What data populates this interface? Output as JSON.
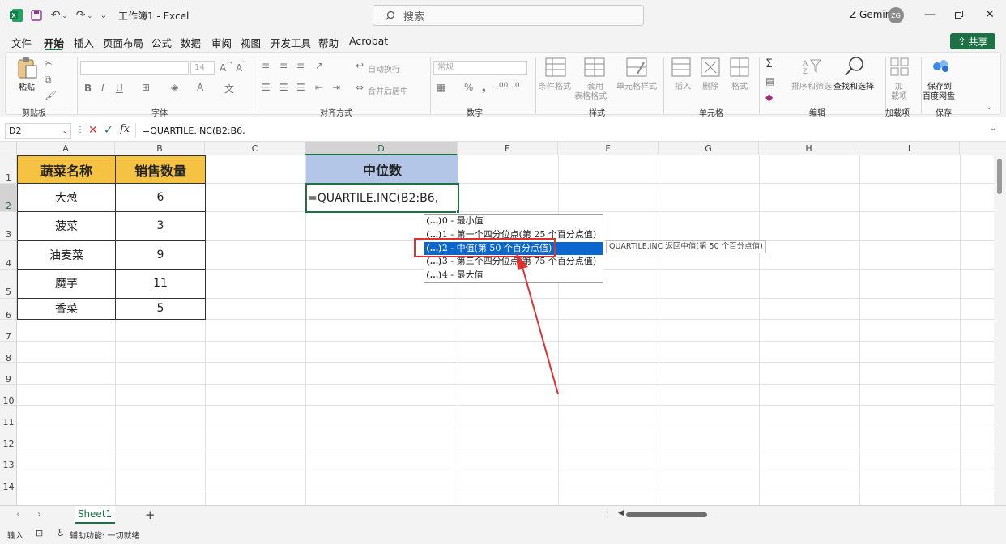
{
  "titlebar": {
    "doc_title": "工作簿1 - Excel",
    "search_placeholder": "搜索",
    "user_name": "Z Gemini",
    "user_initials": "ZG"
  },
  "menu": {
    "tabs": [
      "文件",
      "开始",
      "插入",
      "页面布局",
      "公式",
      "数据",
      "审阅",
      "视图",
      "开发工具",
      "帮助",
      "Acrobat"
    ],
    "active_tab": "开始",
    "share_label": "共享"
  },
  "ribbon": {
    "paste_label": "粘贴",
    "font_size": "14",
    "auto_wrap": "自动换行",
    "merge_center": "合并后居中",
    "number_format": "常规",
    "conditional_format": "条件格式",
    "table_format_1": "套用",
    "table_format_2": "表格格式",
    "cell_style": "单元格样式",
    "insert": "插入",
    "delete": "删除",
    "format": "格式",
    "sort_filter": "排序和筛选",
    "find_select": "查找和选择",
    "addins_1": "加",
    "addins_2": "载项",
    "save_baidu_1": "保存到",
    "save_baidu_2": "百度网盘",
    "groups": {
      "clipboard": "剪贴板",
      "font": "字体",
      "alignment": "对齐方式",
      "number": "数字",
      "styles": "样式",
      "cells": "单元格",
      "editing": "编辑",
      "addins": "加载项",
      "save": "保存"
    }
  },
  "formula_bar": {
    "name_box": "D2",
    "formula": "=QUARTILE.INC(B2:B6,"
  },
  "grid": {
    "columns": [
      "A",
      "B",
      "C",
      "D",
      "E",
      "F",
      "G",
      "H",
      "I"
    ],
    "rows": [
      "1",
      "2",
      "3",
      "4",
      "5",
      "6",
      "7",
      "8",
      "9",
      "10",
      "11",
      "12",
      "13",
      "14"
    ],
    "header_vegetable": "蔬菜名称",
    "header_quantity": "销售数量",
    "vegetables": [
      "大葱",
      "菠菜",
      "油麦菜",
      "魔芋",
      "香菜"
    ],
    "quantities": [
      "6",
      "3",
      "9",
      "11",
      "5"
    ],
    "median_header": "中位数",
    "active_cell_text": "=QUARTILE.INC(B2:B6,"
  },
  "autocomplete": {
    "prefix": "(...)",
    "items": [
      "0 - 最小值",
      "1 - 第一个四分位点(第 25 个百分点值)",
      "2 - 中值(第 50 个百分点值)",
      "3 - 第三个四分位点(第 75 个百分点值)",
      "4 - 最大值"
    ],
    "selected_index": 2,
    "tooltip": "QUARTILE.INC 返回中值(第 50 个百分点值)"
  },
  "sheets": {
    "active": "Sheet1",
    "add_label": "+"
  },
  "status": {
    "mode": "输入",
    "accessibility": "辅助功能: 一切就绪"
  },
  "colors": {
    "excel_green": "#1e7145",
    "header_fill": "#f5c242",
    "median_fill": "#b4c6e7",
    "selection_blue": "#0b67d0",
    "annotation_red": "#e03030"
  }
}
